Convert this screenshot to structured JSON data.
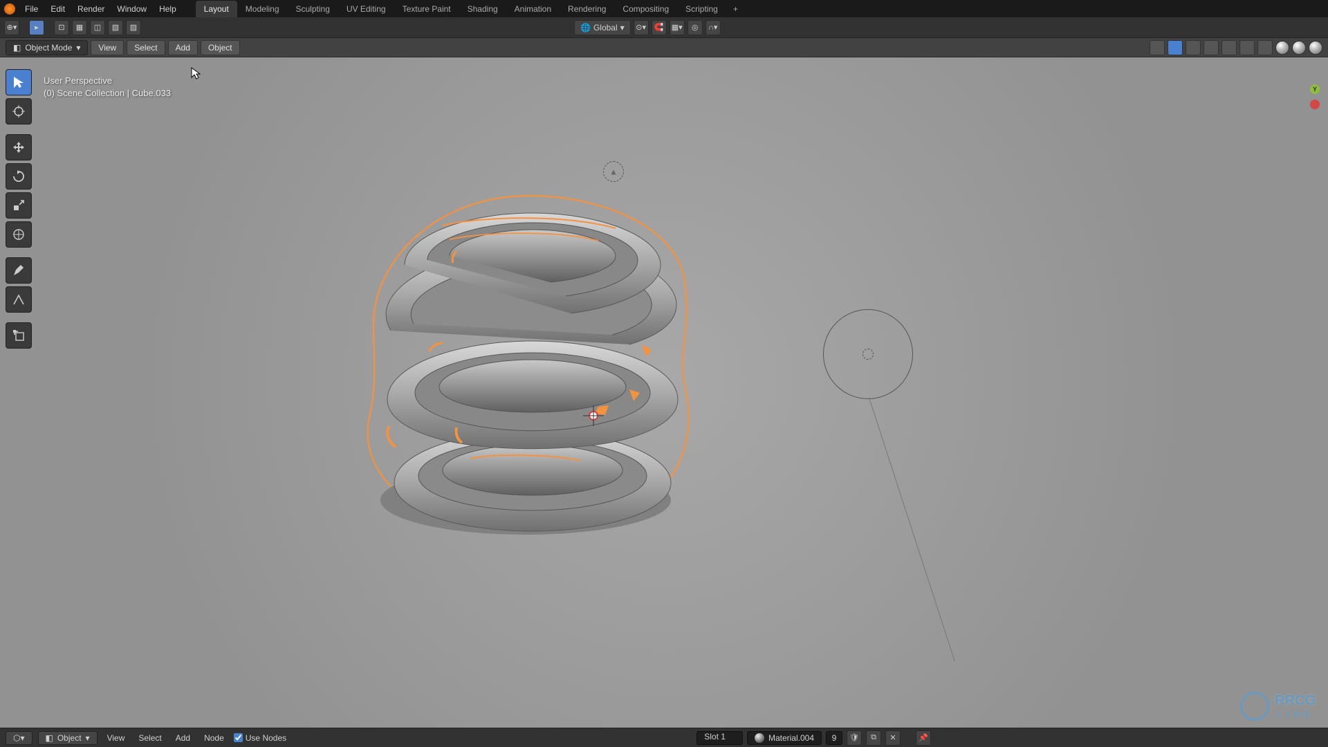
{
  "main_menu": {
    "file": "File",
    "edit": "Edit",
    "render": "Render",
    "window": "Window",
    "help": "Help"
  },
  "workspace_tabs": {
    "layout": "Layout",
    "modeling": "Modeling",
    "sculpting": "Sculpting",
    "uv_editing": "UV Editing",
    "texture_paint": "Texture Paint",
    "shading": "Shading",
    "animation": "Animation",
    "rendering": "Rendering",
    "compositing": "Compositing",
    "scripting": "Scripting"
  },
  "header": {
    "orientation": "Global"
  },
  "sub_header": {
    "mode": "Object Mode",
    "view": "View",
    "select": "Select",
    "add": "Add",
    "object": "Object"
  },
  "viewport_info": {
    "line1": "User Perspective",
    "line2": "(0) Scene Collection | Cube.033"
  },
  "axis": {
    "y": "Y"
  },
  "footer": {
    "editor": "Object",
    "view": "View",
    "select": "Select",
    "add": "Add",
    "node": "Node",
    "use_nodes": "Use Nodes",
    "slot": "Slot 1",
    "material": "Material.004",
    "users": "9"
  },
  "watermark": {
    "text": "RRCG",
    "sub": "人人素材"
  },
  "colors": {
    "selection_outline": "#f5923e",
    "bg": "#9c9c9c"
  }
}
